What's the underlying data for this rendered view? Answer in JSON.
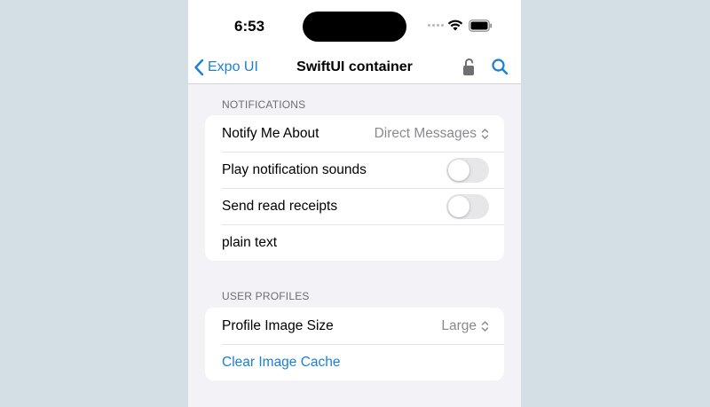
{
  "status_bar": {
    "time": "6:53"
  },
  "nav": {
    "back_label": "Expo UI",
    "title": "SwiftUI container"
  },
  "notifications": {
    "header": "NOTIFICATIONS",
    "rows": {
      "notify_label": "Notify Me About",
      "notify_value": "Direct Messages",
      "sounds_label": "Play notification sounds",
      "sounds_on": false,
      "receipts_label": "Send read receipts",
      "receipts_on": false,
      "plain_text": "plain text"
    }
  },
  "user_profiles": {
    "header": "USER PROFILES",
    "rows": {
      "image_size_label": "Profile Image Size",
      "image_size_value": "Large",
      "clear_cache_label": "Clear Image Cache"
    }
  },
  "colors": {
    "accent": "#1b7fd4",
    "background": "#f2f2f7",
    "outer_background": "#d3dfe5"
  }
}
